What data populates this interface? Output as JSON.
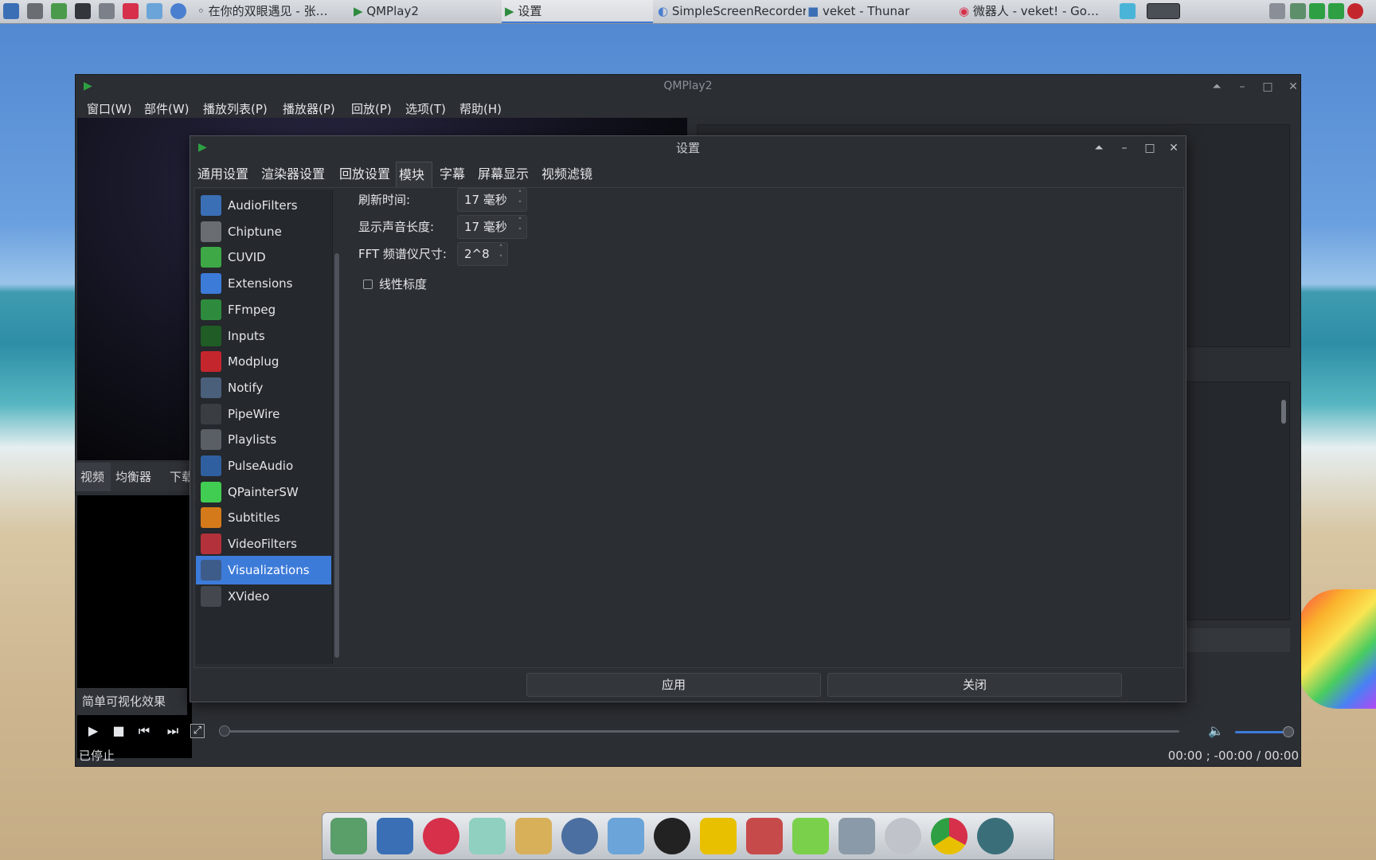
{
  "taskbar": {
    "items": [
      "在你的双眼遇见 - 张…",
      "QMPlay2",
      "设置",
      "SimpleScreenRecorder",
      "veket - Thunar",
      "微器人 - veket! - Go…"
    ]
  },
  "main_window": {
    "title": "QMPlay2",
    "menu": [
      "窗口(W)",
      "部件(W)",
      "播放列表(P)",
      "播放器(P)",
      "回放(P)",
      "选项(T)",
      "帮助(H)"
    ],
    "dock_tabs": [
      "视频",
      "均衡器",
      "下载"
    ],
    "vis_tab": "简单可视化效果",
    "status": "已停止",
    "time": "00:00 ; -00:00 / 00:00"
  },
  "dialog": {
    "title": "设置",
    "tabs": [
      "通用设置",
      "渲染器设置",
      "回放设置",
      "模块",
      "字幕",
      "屏幕显示",
      "视频滤镜"
    ],
    "modules": [
      {
        "name": "AudioFilters",
        "icon": "audio-filters-icon",
        "color": "#3b6fb5"
      },
      {
        "name": "Chiptune",
        "icon": "chip-icon",
        "color": "#6a6d72"
      },
      {
        "name": "CUVID",
        "icon": "cuvid-icon",
        "color": "#3da845"
      },
      {
        "name": "Extensions",
        "icon": "puzzle-icon",
        "color": "#3d7bd9"
      },
      {
        "name": "FFmpeg",
        "icon": "ffmpeg-icon",
        "color": "#2e8b3e"
      },
      {
        "name": "Inputs",
        "icon": "wave-icon",
        "color": "#1f5c26"
      },
      {
        "name": "Modplug",
        "icon": "modplug-icon",
        "color": "#c4262e"
      },
      {
        "name": "Notify",
        "icon": "notify-icon",
        "color": "#4a5f7a"
      },
      {
        "name": "PipeWire",
        "icon": "pipewire-icon",
        "color": "#3a3d42"
      },
      {
        "name": "Playlists",
        "icon": "playlist-icon",
        "color": "#5a5e65"
      },
      {
        "name": "PulseAudio",
        "icon": "pulseaudio-icon",
        "color": "#2f5f9e"
      },
      {
        "name": "QPainterSW",
        "icon": "qt-icon",
        "color": "#41cd52"
      },
      {
        "name": "Subtitles",
        "icon": "subtitles-icon",
        "color": "#d47a1a"
      },
      {
        "name": "VideoFilters",
        "icon": "video-filters-icon",
        "color": "#b3313a"
      },
      {
        "name": "Visualizations",
        "icon": "visualizations-icon",
        "color": "#3d5c8a"
      },
      {
        "name": "XVideo",
        "icon": "xvideo-icon",
        "color": "#44474d"
      }
    ],
    "selected_module": "Visualizations",
    "fields": {
      "refresh_label": "刷新时间:",
      "refresh_value": "17 毫秒",
      "sound_label": "显示声音长度:",
      "sound_value": "17 毫秒",
      "fft_label": "FFT 频谱仪尺寸:",
      "fft_value": "2^8",
      "linear_label": "线性标度",
      "linear_checked": false
    },
    "apply_button": "应用",
    "close_button": "关闭"
  }
}
